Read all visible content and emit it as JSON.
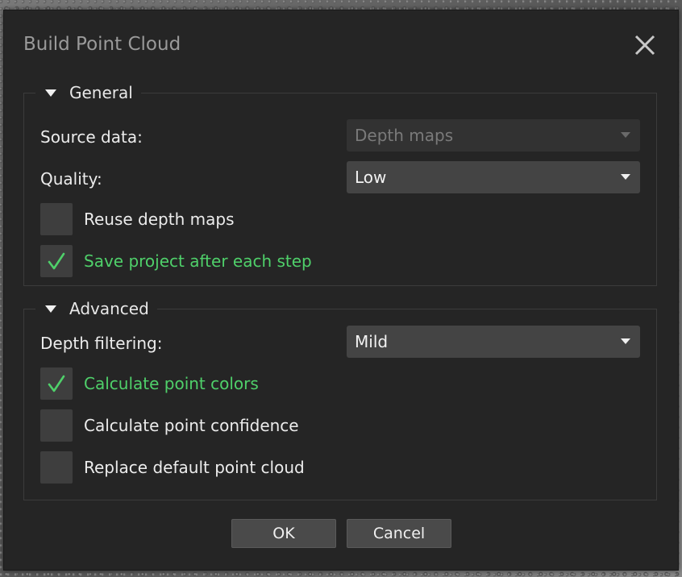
{
  "dialog": {
    "title": "Build Point Cloud",
    "close_icon": "close-icon"
  },
  "general": {
    "title": "General",
    "expanded": true,
    "source_data": {
      "label": "Source data:",
      "value": "Depth maps",
      "enabled": false
    },
    "quality": {
      "label": "Quality:",
      "value": "Low"
    },
    "reuse_depth_maps": {
      "label": "Reuse depth maps",
      "checked": false
    },
    "save_project": {
      "label": "Save project after each step",
      "checked": true
    }
  },
  "advanced": {
    "title": "Advanced",
    "expanded": true,
    "depth_filtering": {
      "label": "Depth filtering:",
      "value": "Mild"
    },
    "calculate_colors": {
      "label": "Calculate point colors",
      "checked": true
    },
    "calculate_confidence": {
      "label": "Calculate point confidence",
      "checked": false
    },
    "replace_default": {
      "label": "Replace default point cloud",
      "checked": false
    }
  },
  "buttons": {
    "ok": "OK",
    "cancel": "Cancel"
  },
  "colors": {
    "dialog_bg": "#252525",
    "checked_text": "#4fd06a",
    "check_mark": "#4fd06a",
    "combo_bg": "#444444"
  }
}
